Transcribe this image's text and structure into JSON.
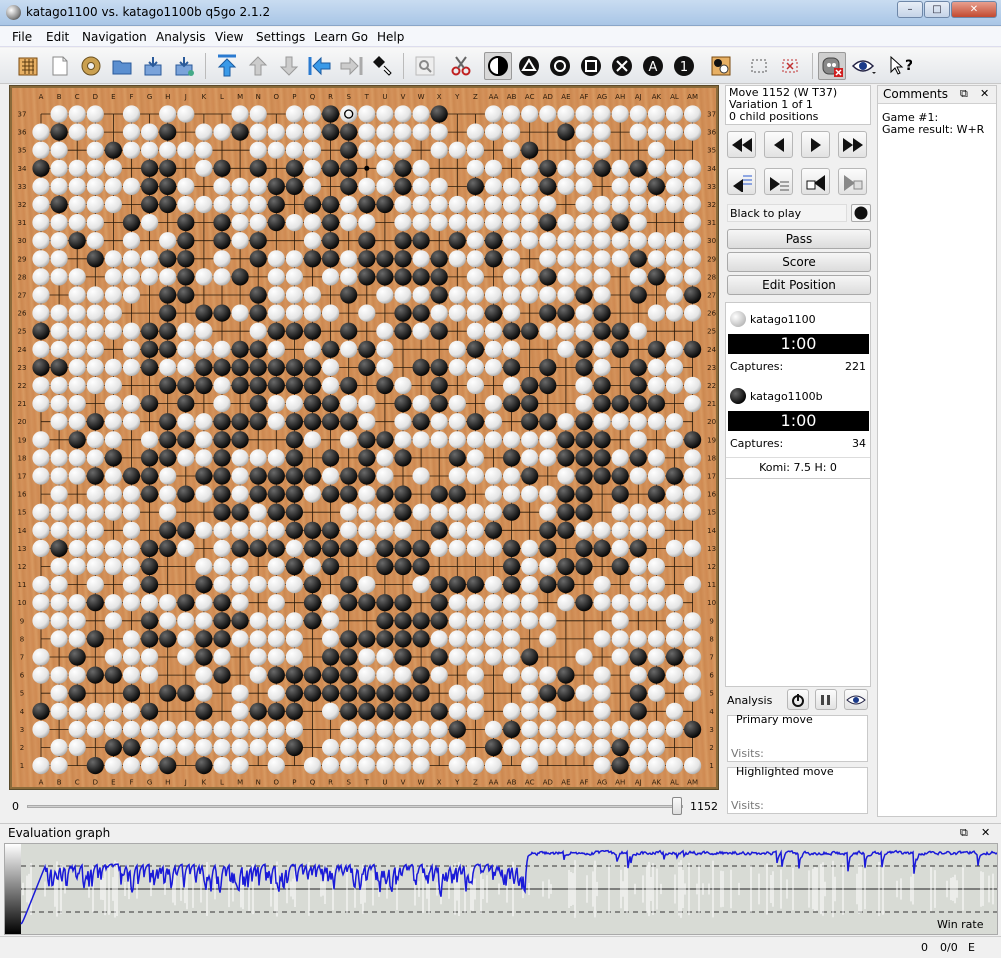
{
  "window": {
    "title": "katago1100 vs. katago1100b   q5go 2.1.2",
    "btn_min": "–",
    "btn_max": "□",
    "btn_close": "✕"
  },
  "menu": [
    "File",
    "Edit",
    "Navigation",
    "Analysis",
    "View",
    "Settings",
    "Learn Go",
    "Help"
  ],
  "toolbar": {
    "icons": [
      "new-board-icon",
      "new-game-icon",
      "donut-icon",
      "open-folder-icon",
      "save-icon",
      "save-as-icon",
      "first-move-icon",
      "prev-variation-icon",
      "next-variation-icon",
      "back-icon",
      "forward-icon",
      "pointer-icon",
      "zoom-icon",
      "cut-icon",
      "color-toggle-icon",
      "triangle-mark-icon",
      "circle-mark-icon",
      "square-mark-icon",
      "cross-mark-icon",
      "letter-mark-icon",
      "number-mark-icon",
      "edit-stones-icon",
      "select-rect-icon",
      "clear-marks-icon",
      "engine-icon",
      "eye-icon",
      "whats-this-icon"
    ],
    "letter_label": "A",
    "number_label": "1"
  },
  "board": {
    "size": 37,
    "col_labels": [
      "A",
      "B",
      "C",
      "D",
      "E",
      "F",
      "G",
      "H",
      "J",
      "K",
      "L",
      "M",
      "N",
      "O",
      "P",
      "Q",
      "R",
      "S",
      "T",
      "U",
      "V",
      "W",
      "X",
      "Y",
      "Z",
      "AA",
      "AB",
      "AC",
      "AD",
      "AE",
      "AF",
      "AG",
      "AH",
      "AJ",
      "AK",
      "AL",
      "AM"
    ],
    "last_move": "T37",
    "colors": {
      "wood": "#d3915a",
      "line": "#2a1a0a"
    }
  },
  "slider": {
    "min_label": "0",
    "max_label": "1152",
    "value": 1152,
    "max": 1152
  },
  "move_info": {
    "line1": "Move 1152 (W T37)",
    "line2": "Variation 1 of 1",
    "line3": "0 child positions"
  },
  "to_play": "Black to play",
  "buttons": {
    "pass": "Pass",
    "score": "Score",
    "edit_position": "Edit Position"
  },
  "players": {
    "white": {
      "name": "katago1100",
      "clock": "1:00",
      "captures_label": "Captures:",
      "captures": "221"
    },
    "black": {
      "name": "katago1100b",
      "clock": "1:00",
      "captures_label": "Captures:",
      "captures": "34"
    }
  },
  "komi": "Komi:  7.5  H:  0",
  "analysis": {
    "label": "Analysis",
    "primary_move": "Primary move",
    "highlighted_move": "Highlighted move",
    "visits_label": "Visits:"
  },
  "comments": {
    "title": "Comments",
    "line1": "Game #1:",
    "line2": "Game result: W+R"
  },
  "eval": {
    "title": "Evaluation graph",
    "win_rate": "Win rate"
  },
  "status": {
    "a": "0",
    "b": "0/0",
    "c": "E"
  }
}
